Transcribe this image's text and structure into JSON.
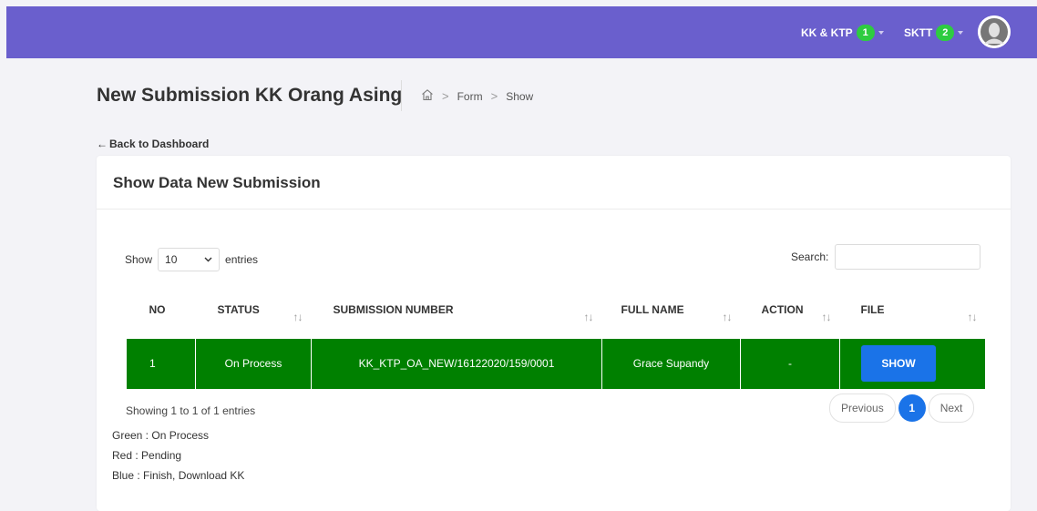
{
  "navbar": {
    "items": [
      {
        "label": "KK & KTP",
        "count": "1"
      },
      {
        "label": "SKTT",
        "count": "2"
      }
    ]
  },
  "page": {
    "title": "New Submission KK Orang Asing",
    "breadcrumb": [
      "Form",
      "Show"
    ],
    "back_link": "Back to Dashboard"
  },
  "card": {
    "title": "Show Data New Submission",
    "length": {
      "prefix": "Show",
      "value": "10",
      "suffix": "entries"
    },
    "search_label": "Search:",
    "table": {
      "headers": [
        "NO",
        "STATUS",
        "SUBMISSION NUMBER",
        "FULL NAME",
        "ACTION",
        "FILE"
      ],
      "rows": [
        {
          "no": "1",
          "status": "On Process",
          "submission_number": "KK_KTP_OA_NEW/16122020/159/0001",
          "full_name": "Grace Supandy",
          "action": "-",
          "file_button": "SHOW"
        }
      ],
      "row_color": "#008000"
    },
    "info": "Showing 1 to 1 of 1 entries",
    "pagination": {
      "previous": "Previous",
      "current": "1",
      "next": "Next"
    },
    "legend": [
      "Green : On Process",
      "Red : Pending",
      "Blue : Finish, Download KK"
    ]
  },
  "colors": {
    "navbar": "#6a5fcd",
    "badge": "#2ecc40",
    "accent": "#1a73e8"
  }
}
